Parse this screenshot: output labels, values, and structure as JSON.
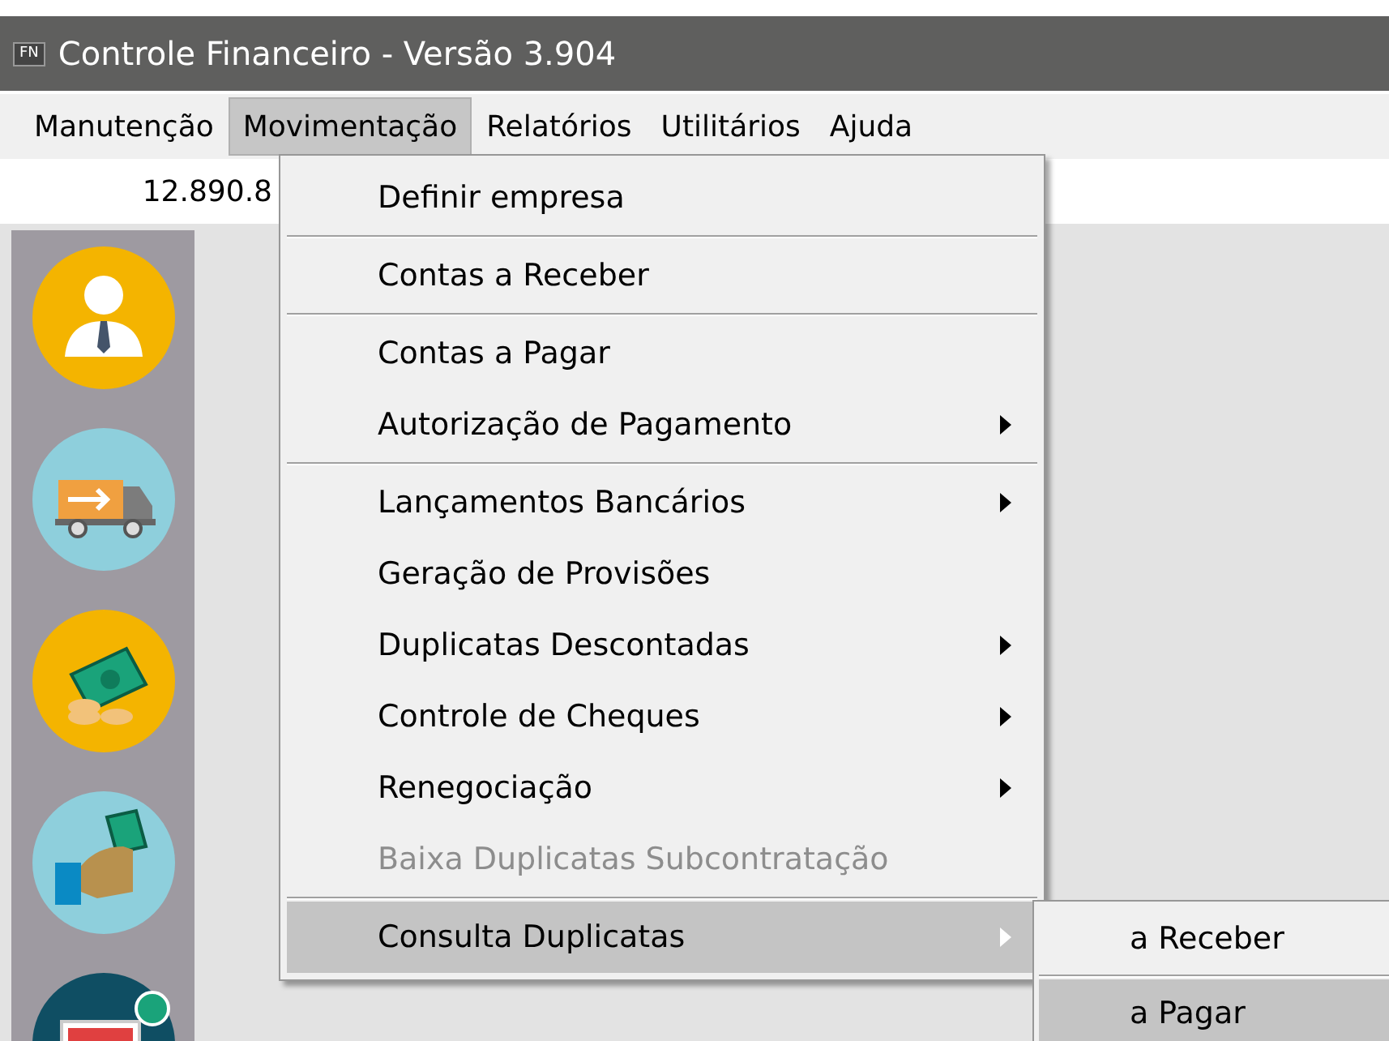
{
  "window": {
    "logo": "FN",
    "title": "Controle Financeiro - Versão 3.904"
  },
  "menubar": [
    {
      "label": "Manutenção",
      "selected": false
    },
    {
      "label": "Movimentação",
      "selected": true
    },
    {
      "label": "Relatórios",
      "selected": false
    },
    {
      "label": "Utilitários",
      "selected": false
    },
    {
      "label": "Ajuda",
      "selected": false
    }
  ],
  "value_field": {
    "value": "12.890.8"
  },
  "dropdown": [
    {
      "kind": "item",
      "label": "Definir empresa",
      "selected": false,
      "disabled": false,
      "submenu": false
    },
    {
      "kind": "separator"
    },
    {
      "kind": "item",
      "label": "Contas a Receber",
      "selected": false,
      "disabled": false,
      "submenu": false
    },
    {
      "kind": "separator"
    },
    {
      "kind": "item",
      "label": "Contas a Pagar",
      "selected": false,
      "disabled": false,
      "submenu": false
    },
    {
      "kind": "item",
      "label": "Autorização de Pagamento",
      "selected": false,
      "disabled": false,
      "submenu": true
    },
    {
      "kind": "separator"
    },
    {
      "kind": "item",
      "label": "Lançamentos Bancários",
      "selected": false,
      "disabled": false,
      "submenu": true
    },
    {
      "kind": "item",
      "label": "Geração de Provisões",
      "selected": false,
      "disabled": false,
      "submenu": false
    },
    {
      "kind": "item",
      "label": "Duplicatas Descontadas",
      "selected": false,
      "disabled": false,
      "submenu": true
    },
    {
      "kind": "item",
      "label": "Controle de Cheques",
      "selected": false,
      "disabled": false,
      "submenu": true
    },
    {
      "kind": "item",
      "label": "Renegociação",
      "selected": false,
      "disabled": false,
      "submenu": true
    },
    {
      "kind": "item",
      "label": "Baixa Duplicatas Subcontratação",
      "selected": false,
      "disabled": true,
      "submenu": false
    },
    {
      "kind": "separator"
    },
    {
      "kind": "item",
      "label": "Consulta Duplicatas",
      "selected": true,
      "disabled": false,
      "submenu": true
    }
  ],
  "submenu": [
    {
      "kind": "item",
      "label": "a Receber",
      "selected": false
    },
    {
      "kind": "separator"
    },
    {
      "kind": "item",
      "label": "a Pagar",
      "selected": true
    }
  ],
  "sidebar": [
    {
      "kind": "person"
    },
    {
      "kind": "truck"
    },
    {
      "kind": "money"
    },
    {
      "kind": "hand"
    },
    {
      "kind": "monitor"
    }
  ]
}
